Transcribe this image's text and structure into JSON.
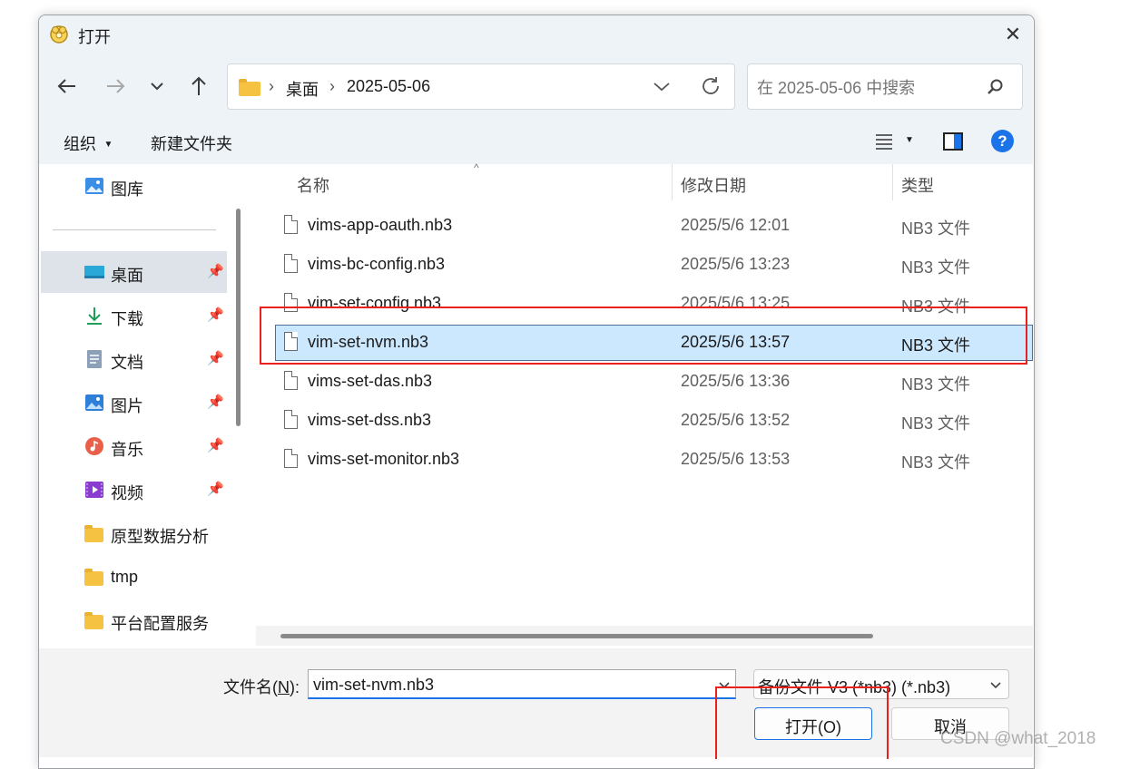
{
  "window": {
    "title": "打开",
    "close_label": "✕"
  },
  "navigation": {
    "back_icon": "arrow-left-icon",
    "forward_icon": "arrow-right-icon",
    "recent_icon": "chevron-down-icon",
    "up_icon": "arrow-up-icon"
  },
  "address": {
    "breadcrumbs": [
      "桌面",
      "2025-05-06"
    ],
    "separator": "›"
  },
  "search": {
    "placeholder": "在 2025-05-06 中搜索"
  },
  "commands": {
    "organize_label": "组织",
    "new_folder_label": "新建文件夹"
  },
  "sidebar": {
    "items": [
      {
        "label": "图库",
        "icon": "gallery-icon",
        "pinned": false,
        "selected": false
      },
      {
        "label": "桌面",
        "icon": "desktop-icon",
        "pinned": true,
        "selected": true
      },
      {
        "label": "下载",
        "icon": "download-icon",
        "pinned": true,
        "selected": false
      },
      {
        "label": "文档",
        "icon": "document-icon",
        "pinned": true,
        "selected": false
      },
      {
        "label": "图片",
        "icon": "pictures-icon",
        "pinned": true,
        "selected": false
      },
      {
        "label": "音乐",
        "icon": "music-icon",
        "pinned": true,
        "selected": false
      },
      {
        "label": "视频",
        "icon": "video-icon",
        "pinned": true,
        "selected": false
      },
      {
        "label": "原型数据分析",
        "icon": "folder-icon",
        "pinned": false,
        "selected": false
      },
      {
        "label": "tmp",
        "icon": "folder-icon",
        "pinned": false,
        "selected": false
      },
      {
        "label": "平台配置服务",
        "icon": "folder-icon",
        "pinned": false,
        "selected": false
      }
    ]
  },
  "files": {
    "columns": {
      "name": "名称",
      "modified": "修改日期",
      "type": "类型"
    },
    "rows": [
      {
        "name": "vims-app-oauth.nb3",
        "modified": "2025/5/6 12:01",
        "type": "NB3 文件",
        "selected": false
      },
      {
        "name": "vims-bc-config.nb3",
        "modified": "2025/5/6 13:23",
        "type": "NB3 文件",
        "selected": false
      },
      {
        "name": "vim-set-config.nb3",
        "modified": "2025/5/6 13:25",
        "type": "NB3 文件",
        "selected": false
      },
      {
        "name": "vim-set-nvm.nb3",
        "modified": "2025/5/6 13:57",
        "type": "NB3 文件",
        "selected": true
      },
      {
        "name": "vims-set-das.nb3",
        "modified": "2025/5/6 13:36",
        "type": "NB3 文件",
        "selected": false
      },
      {
        "name": "vims-set-dss.nb3",
        "modified": "2025/5/6 13:52",
        "type": "NB3 文件",
        "selected": false
      },
      {
        "name": "vims-set-monitor.nb3",
        "modified": "2025/5/6 13:53",
        "type": "NB3 文件",
        "selected": false
      }
    ]
  },
  "bottom": {
    "filename_label_prefix": "文件名(",
    "filename_label_key": "N",
    "filename_label_suffix": "):",
    "filename_value": "vim-set-nvm.nb3",
    "filter_value": "备份文件 V3 (*nb3) (*.nb3)",
    "open_label": "打开(O)",
    "cancel_label": "取消"
  },
  "watermark": "CSDN @what_2018",
  "colors": {
    "chrome": "#eef3f8",
    "selection": "#cce8ff",
    "selection_border": "#4a6f99",
    "annotation": "#e8211c",
    "help": "#1a73e8"
  }
}
